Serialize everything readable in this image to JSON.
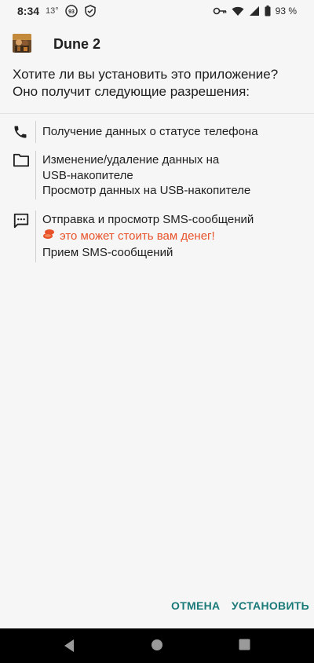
{
  "status_bar": {
    "time": "8:34",
    "temperature": "13°",
    "notification_badge": "93",
    "battery": "93 %",
    "icons": [
      "temperature-icon",
      "badge-icon",
      "shield-icon",
      "key-icon",
      "wifi-icon",
      "signal-icon",
      "battery-icon"
    ]
  },
  "header": {
    "app_name": "Dune 2",
    "question": "Хотите ли вы установить это приложение? Оно получит следующие разрешения:"
  },
  "permissions": [
    {
      "icon": "phone-icon",
      "items": [
        "Получение данных о статусе телефона"
      ]
    },
    {
      "icon": "folder-icon",
      "items": [
        "Изменение/удаление данных на USB-накопителе",
        "Просмотр данных на USB-накопителе"
      ]
    },
    {
      "icon": "sms-icon",
      "items": [
        "Отправка и просмотр SMS-сообщений",
        "Прием SMS-сообщений"
      ],
      "warning": "это может стоить вам денег!"
    }
  ],
  "buttons": {
    "cancel": "ОТМЕНА",
    "install": "УСТАНОВИТЬ"
  },
  "colors": {
    "accent": "#1a7a78",
    "warning": "#e8522a",
    "background": "#f6f6f6"
  },
  "nav_bar": {
    "icons": [
      "back-icon",
      "home-icon",
      "recents-icon"
    ]
  }
}
